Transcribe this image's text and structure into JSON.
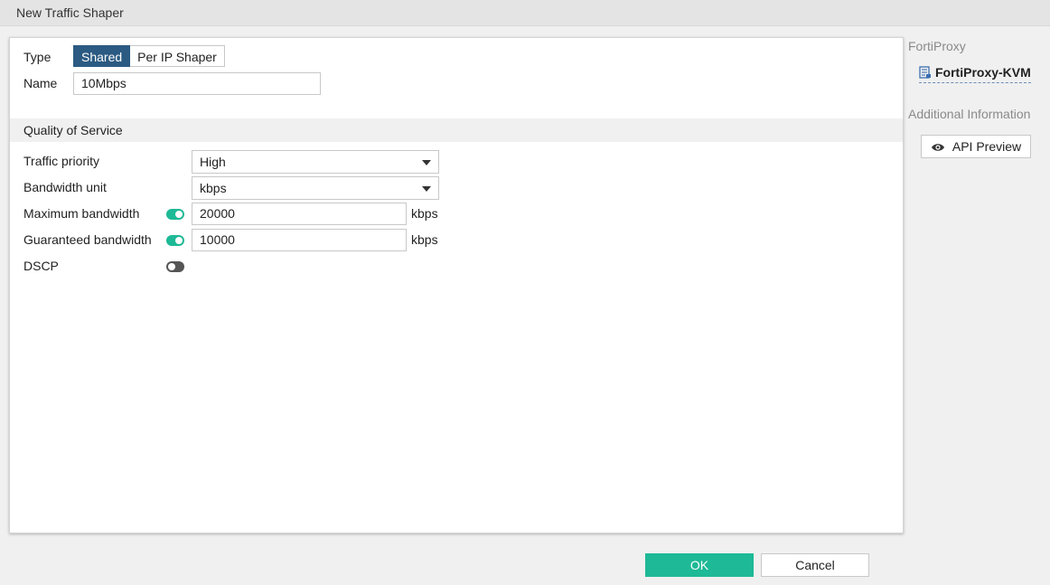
{
  "window": {
    "title": "New Traffic Shaper"
  },
  "form": {
    "type_label": "Type",
    "type_options": [
      "Shared",
      "Per IP Shaper"
    ],
    "type_selected": "Shared",
    "name_label": "Name",
    "name_value": "10Mbps"
  },
  "qos": {
    "section_title": "Quality of Service",
    "traffic_priority": {
      "label": "Traffic priority",
      "value": "High"
    },
    "bandwidth_unit": {
      "label": "Bandwidth unit",
      "value": "kbps"
    },
    "maximum_bandwidth": {
      "label": "Maximum bandwidth",
      "enabled": true,
      "value": "20000",
      "unit": "kbps"
    },
    "guaranteed_bandwidth": {
      "label": "Guaranteed bandwidth",
      "enabled": true,
      "value": "10000",
      "unit": "kbps"
    },
    "dscp": {
      "label": "DSCP",
      "enabled": false
    }
  },
  "sidebar": {
    "device_heading": "FortiProxy",
    "device_name": "FortiProxy-KVM",
    "additional_heading": "Additional Information",
    "api_preview_label": "API Preview"
  },
  "footer": {
    "ok_label": "OK",
    "cancel_label": "Cancel"
  },
  "colors": {
    "accent": "#1eb996",
    "selected_segment": "#2b5a82",
    "toggle_off": "#555555"
  },
  "icons": {
    "device": "device-config-icon",
    "api_preview": "eye-icon"
  }
}
